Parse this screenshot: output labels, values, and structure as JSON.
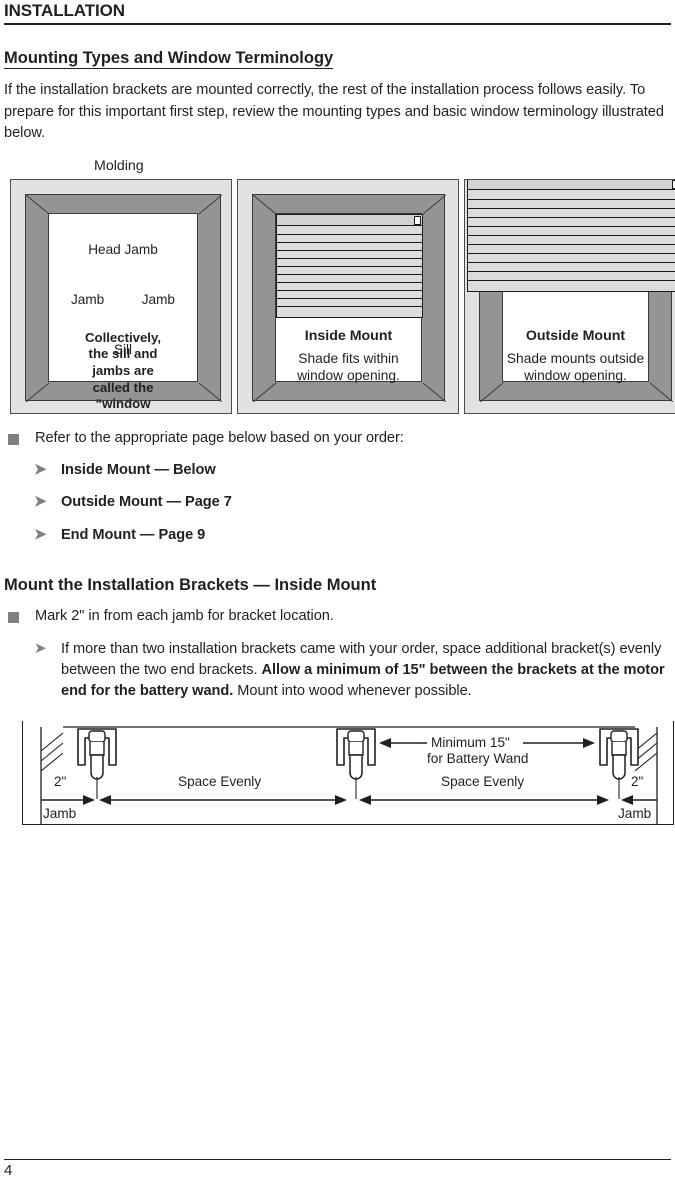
{
  "running_head": "INSTALLATION",
  "section": {
    "heading": "Mounting Types and Window Terminology",
    "intro": "If the installation brackets are mounted correctly, the rest of the installation process follows easily. To prepare for this important first step, review the mounting types and basic window terminology illustrated below."
  },
  "diagram": {
    "molding_label": "Molding",
    "window": {
      "head_jamb": "Head Jamb",
      "jamb_left": "Jamb",
      "jamb_right": "Jamb",
      "sill": "Sill",
      "casement_note": "Collectively, the sill and jambs are called the “window casement.”"
    },
    "inside_mount": {
      "title": "Inside Mount",
      "description": "Shade fits within window opening."
    },
    "outside_mount": {
      "title": "Outside Mount",
      "description": "Shade mounts outside window opening."
    }
  },
  "refer_list": {
    "lead": "Refer to the appropriate page below based on your order:",
    "items": [
      "Inside Mount — Below",
      "Outside Mount — Page 7",
      "End Mount — Page 9"
    ]
  },
  "brackets_section": {
    "heading": "Mount the Installation Brackets — Inside Mount",
    "bullet": "Mark 2\" in from each jamb for bracket location.",
    "sub_bullet": {
      "part1": "If more than two installation brackets came with your order, space additional bracket(s) evenly between the two end brackets. ",
      "bold": "Allow a minimum of 15\" between the brackets at the motor end for the battery wand.",
      "part2": " Mount into wood whenever possible."
    }
  },
  "bracket_diagram": {
    "dim_left": "2\"",
    "dim_right": "2\"",
    "space_left": "Space Evenly",
    "space_right": "Space Evenly",
    "minimum_line1": "Minimum 15\"",
    "minimum_line2": "for Battery Wand",
    "jamb_left": "Jamb",
    "jamb_right": "Jamb"
  },
  "footer": {
    "page_number": "4"
  },
  "colors": {
    "ink": "#231f20",
    "bullet_square": "#808080",
    "bullet_arrow": "#808080",
    "panel_background": "#e2e2e2",
    "frame_gray": "#949494",
    "shade_gray": "#dcdcdc"
  }
}
